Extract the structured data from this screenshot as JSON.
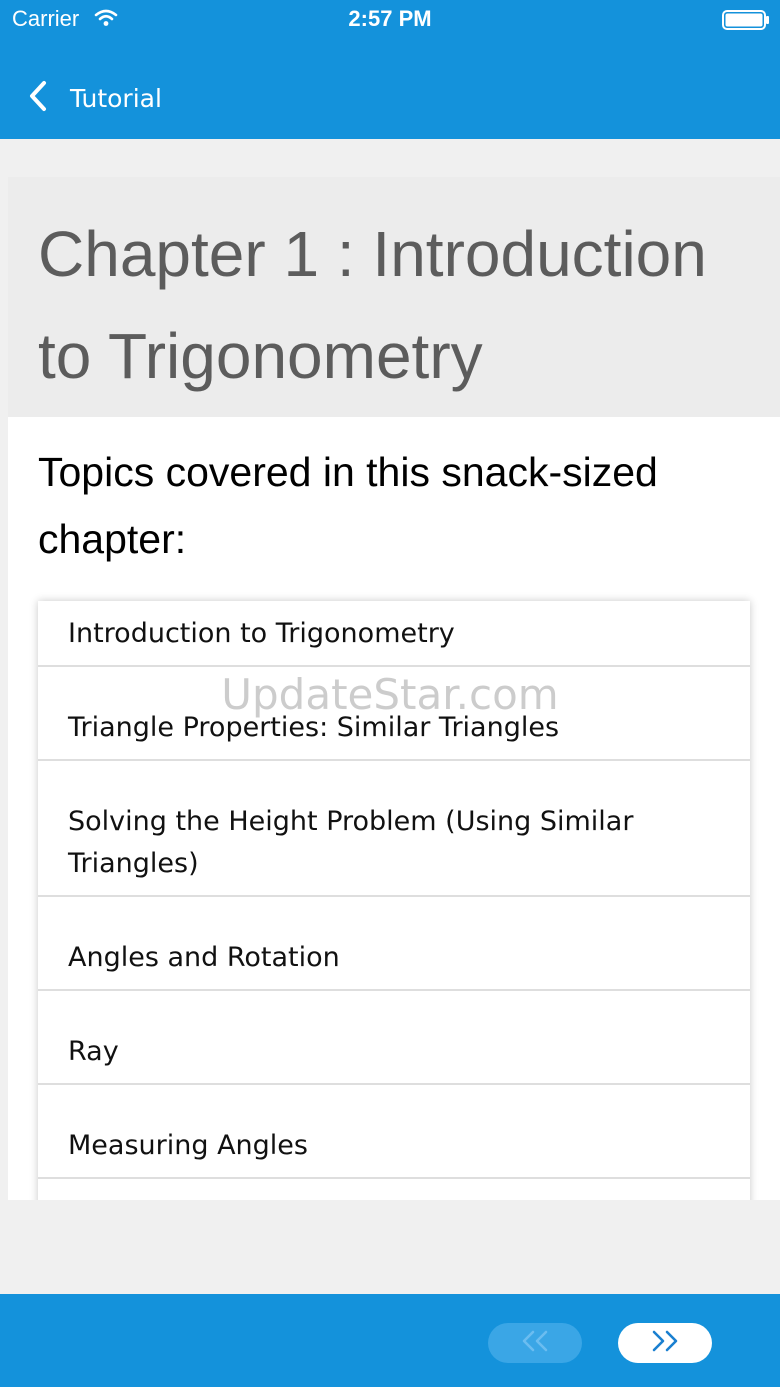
{
  "status_bar": {
    "carrier": "Carrier",
    "time": "2:57 PM",
    "icons": [
      "wifi-icon",
      "battery-icon"
    ]
  },
  "nav_bar": {
    "back_icon": "chevron-left-icon",
    "back_title": "Tutorial"
  },
  "chapter": {
    "title": "Chapter 1 : Introduction to Trigonometry"
  },
  "topics": {
    "heading": "Topics covered in this snack-sized chapter:",
    "items": [
      "Introduction to Trigonometry",
      "Triangle Properties: Similar Triangles",
      "Solving the Height Problem (Using Similar Triangles)",
      "Angles and Rotation",
      "Ray",
      "Measuring Angles"
    ]
  },
  "watermark": "UpdateStar.com",
  "pager": {
    "prev_icon": "double-chevron-left-icon",
    "next_icon": "double-chevron-right-icon"
  },
  "colors": {
    "brand_blue": "#1492db",
    "prev_disabled": "#3aa6e6",
    "header_text": "#5c5c5c"
  }
}
